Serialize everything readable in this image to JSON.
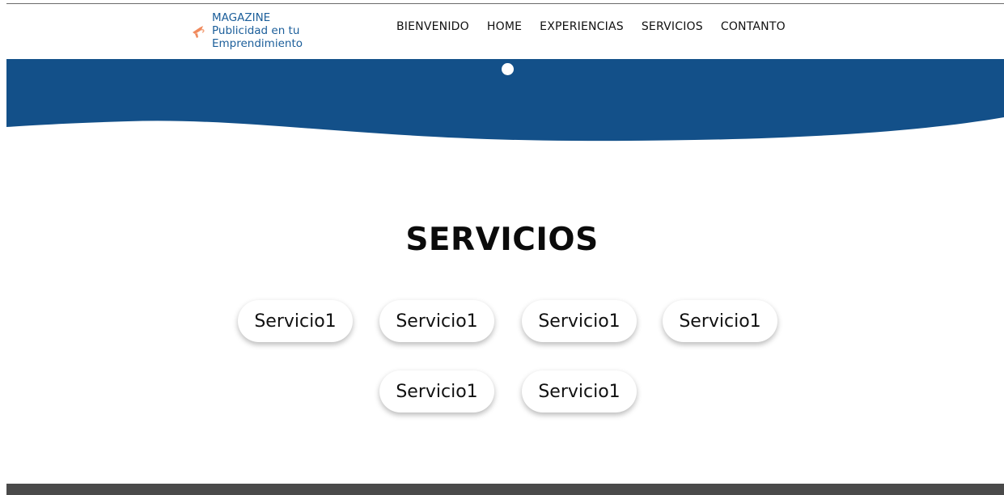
{
  "brand": {
    "line1": "MAGAZINE",
    "line2": "Publicidad en tu",
    "line3": "Emprendimiento",
    "icon": "megaphone-icon",
    "color": "#1b5e9a",
    "icon_color": "#f08a5d"
  },
  "nav": {
    "items": [
      {
        "label": "BIENVENIDO"
      },
      {
        "label": "HOME"
      },
      {
        "label": "EXPERIENCIAS"
      },
      {
        "label": "SERVICIOS"
      },
      {
        "label": "CONTANTO"
      }
    ]
  },
  "hero": {
    "color": "#135089"
  },
  "services": {
    "title": "SERVICIOS",
    "items": [
      {
        "label": "Servicio1"
      },
      {
        "label": "Servicio1"
      },
      {
        "label": "Servicio1"
      },
      {
        "label": "Servicio1"
      },
      {
        "label": "Servicio1"
      },
      {
        "label": "Servicio1"
      }
    ]
  },
  "footer": {
    "color": "#4a4a4a"
  }
}
